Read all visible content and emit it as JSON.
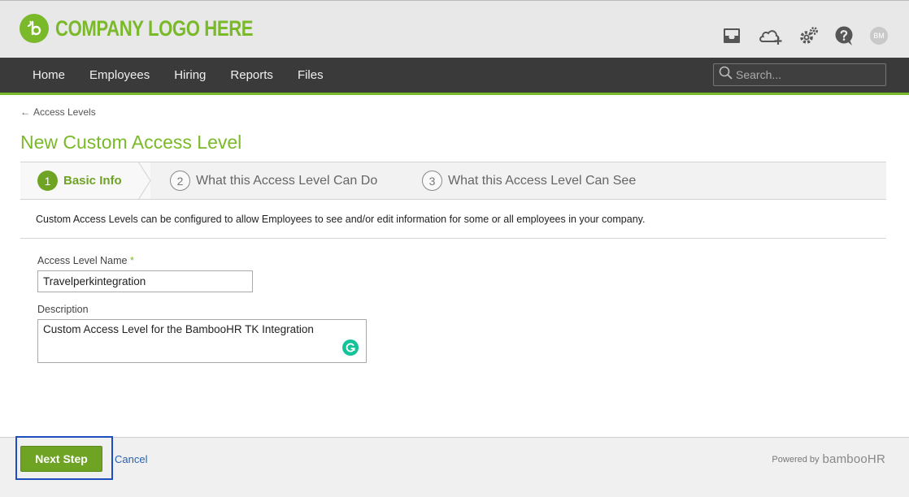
{
  "header": {
    "logo_text": "COMPANY LOGO HERE",
    "avatar_initials": "BM",
    "brand_color": "#7ab929",
    "icons": [
      "inbox-icon",
      "cloud-plus-icon",
      "gear-icon",
      "help-icon"
    ]
  },
  "nav": {
    "items": [
      {
        "label": "Home"
      },
      {
        "label": "Employees"
      },
      {
        "label": "Hiring"
      },
      {
        "label": "Reports"
      },
      {
        "label": "Files"
      }
    ],
    "search_placeholder": "Search..."
  },
  "breadcrumb": {
    "back_label": "Access Levels"
  },
  "page": {
    "title": "New Custom Access Level"
  },
  "steps": [
    {
      "number": "1",
      "label": "Basic Info",
      "active": true
    },
    {
      "number": "2",
      "label": "What this Access Level Can Do",
      "active": false
    },
    {
      "number": "3",
      "label": "What this Access Level Can See",
      "active": false
    }
  ],
  "intro_text": "Custom Access Levels can be configured to allow Employees to see and/or edit information for some or all employees in your company.",
  "form": {
    "name_label": "Access Level Name",
    "required_marker": "*",
    "name_value": "Travelperkintegration",
    "description_label": "Description",
    "description_value": "Custom Access Level for the BambooHR TK Integration"
  },
  "footer": {
    "next_label": "Next Step",
    "cancel_label": "Cancel",
    "powered_by": "Powered by",
    "powered_brand": "bambooHR"
  }
}
